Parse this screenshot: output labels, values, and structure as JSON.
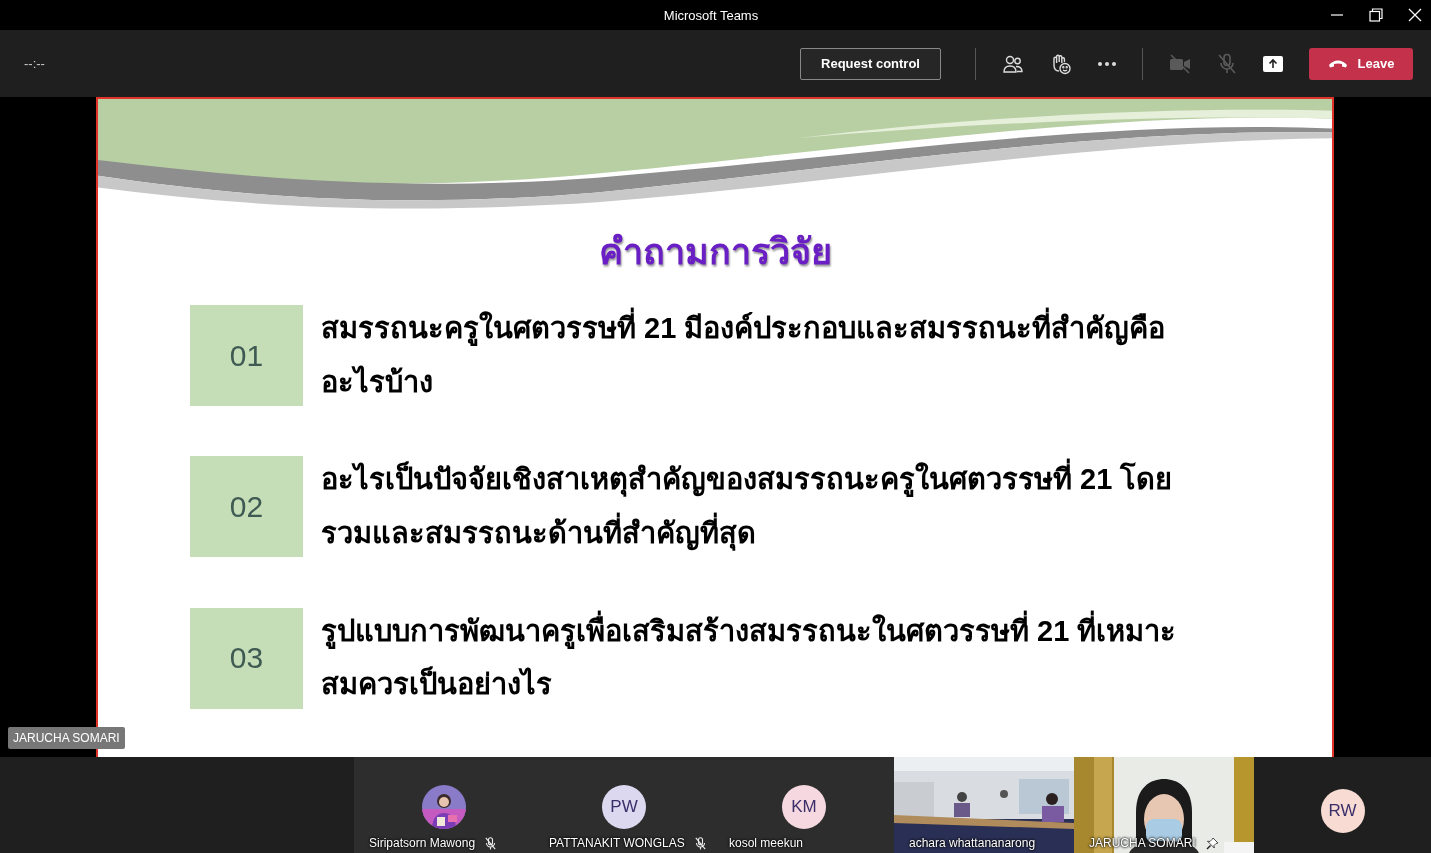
{
  "window": {
    "title": "Microsoft Teams"
  },
  "toolbar": {
    "timer": "--:--",
    "request_control": "Request control",
    "leave": "Leave"
  },
  "slide": {
    "title": "คำถามการวิจัย",
    "items": [
      {
        "number": "01",
        "text": "สมรรถนะครูในศตวรรษที่ 21 มีองค์ประกอบและสมรรถนะที่สำคัญคืออะไรบ้าง"
      },
      {
        "number": "02",
        "text": "อะไรเป็นปัจจัยเชิงสาเหตุสำคัญของสมรรถนะครูในศตวรรษที่ 21 โดยรวมและสมรรถนะด้านที่สำคัญที่สุด"
      },
      {
        "number": "03",
        "text": "รูปแบบการพัฒนาครูเพื่อเสริมสร้างสมรรถนะในศตวรรษที่ 21 ที่เหมาะสมควรเป็นอย่างไร"
      }
    ]
  },
  "presenter_label": "JARUCHA SOMARI",
  "participants": [
    {
      "name": "Siripatsorn Mawong",
      "muted": true,
      "pinned": false
    },
    {
      "kind": "initials",
      "initials": "PW",
      "color": "#dcd8f0",
      "name": "PATTANAKIT WONGLAS",
      "muted": true,
      "pinned": false
    },
    {
      "kind": "initials",
      "initials": "KM",
      "color": "#f6d9e0",
      "name": "kosol meekun",
      "muted": false,
      "pinned": false
    },
    {
      "kind": "video",
      "name": "achara whattananarong",
      "muted": false,
      "pinned": false
    },
    {
      "kind": "video2",
      "name": "JARUCHA SOMARI",
      "muted": false,
      "pinned": true
    },
    {
      "kind": "initials",
      "initials": "RW",
      "color": "#f8dcd4",
      "muted": false,
      "pinned": false
    }
  ]
}
